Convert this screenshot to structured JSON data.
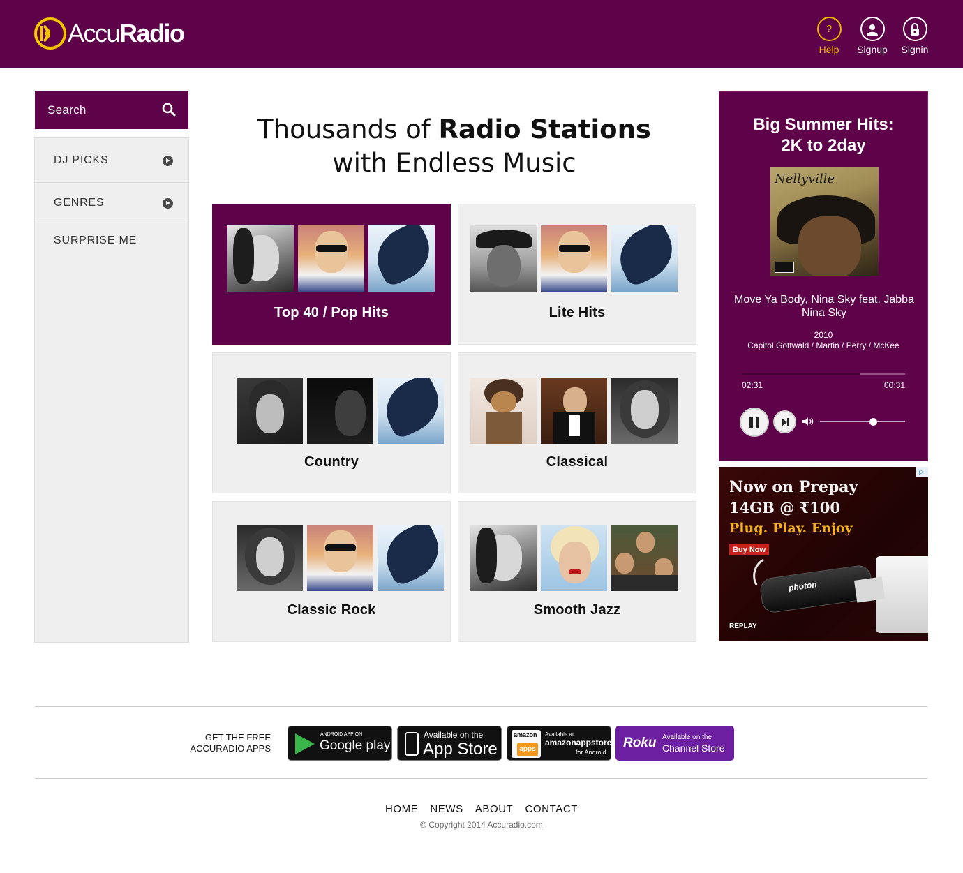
{
  "header": {
    "logo_accu": "Accu",
    "logo_radio": "Radio",
    "help_icon": "?",
    "help_label": "Help",
    "signup_label": "Signup",
    "signin_label": "Signin",
    "background": "#5e0249",
    "accent": "#f0b400"
  },
  "search": {
    "placeholder": "Search",
    "icon": "search-icon"
  },
  "sidebar": {
    "items": [
      {
        "label": "DJ PICKS",
        "icon": "play-circle-icon"
      },
      {
        "label": "GENRES",
        "icon": "play-circle-icon"
      },
      {
        "label": "SURPRISE ME"
      }
    ]
  },
  "headline": {
    "line1_regular": "Thousands of ",
    "line1_bold": "Radio Stations",
    "line2": "with Endless Music"
  },
  "stations": [
    {
      "title": "Top 40 / Pop Hits",
      "active": true
    },
    {
      "title": "Lite Hits",
      "active": false
    },
    {
      "title": "Country",
      "active": false
    },
    {
      "title": "Classical",
      "active": false
    },
    {
      "title": "Classic Rock",
      "active": false
    },
    {
      "title": "Smooth Jazz",
      "active": false
    }
  ],
  "player": {
    "title_line1": "Big Summer Hits:",
    "title_line2": "2K to 2day",
    "album_art_text": "Nellyville",
    "song": "Move Ya Body, Nina Sky feat. Jabba Nina Sky",
    "year": "2010",
    "label": "Capitol Gottwald / Martin / Perry / McKee",
    "elapsed": "02:31",
    "remaining": "00:31",
    "progress": 0.72,
    "volume": 0.63
  },
  "ad": {
    "line1": "Now on Prepay",
    "line2": "14GB @ ₹100",
    "line3": "Plug. Play. Enjoy",
    "cta": "Buy Now",
    "brand": "photon",
    "footer": "REPLAY",
    "badge": "▷"
  },
  "apps": {
    "label_line1": "GET THE FREE",
    "label_line2": "ACCURADIO APPS",
    "google_small": "ANDROID APP ON",
    "google_big": "Google play",
    "apple_small": "Available on the",
    "apple_big": "App Store",
    "amazon_word": "amazon",
    "amazon_apps": "apps",
    "amazon_small": "Available at",
    "amazon_big": "amazonappstore",
    "amazon_sub": "for Android",
    "roku_word": "Roku",
    "roku_small": "Available on the",
    "roku_big": "Channel Store"
  },
  "footer": {
    "links": [
      "HOME",
      "NEWS",
      "ABOUT",
      "CONTACT"
    ],
    "copyright": "© Copyright 2014 Accuradio.com"
  }
}
